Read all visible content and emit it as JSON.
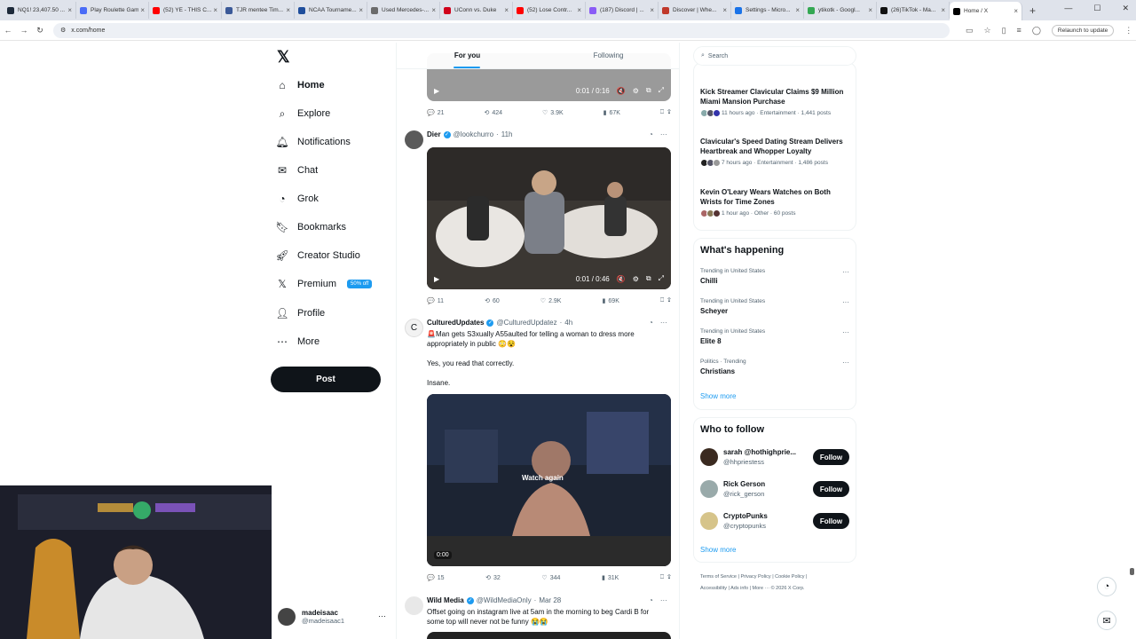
{
  "browser": {
    "tabs": [
      {
        "label": "NQ1! 23,407.50 ...",
        "color": "#1e2a3a"
      },
      {
        "label": "Play Roulette Game",
        "color": "#4a6cf7"
      },
      {
        "label": "(52) YE - THIS C...",
        "color": "#ff0000"
      },
      {
        "label": "TJR mentee Tim...",
        "color": "#3b5998"
      },
      {
        "label": "NCAA Tourname...",
        "color": "#1f4e9c"
      },
      {
        "label": "Used Mercedes-...",
        "color": "#6b6b6b"
      },
      {
        "label": "UConn vs. Duke",
        "color": "#d0021b"
      },
      {
        "label": "(52) Lose Contr...",
        "color": "#ff0000"
      },
      {
        "label": "(187) Discord | ...",
        "color": "#8a5cf6"
      },
      {
        "label": "Discover | Whe...",
        "color": "#c0392b"
      },
      {
        "label": "Settings - Micro...",
        "color": "#1a73e8"
      },
      {
        "label": "ytikotk - Googl...",
        "color": "#34a853"
      },
      {
        "label": "(26)TikTok - Ma...",
        "color": "#111111"
      },
      {
        "label": "Home / X",
        "color": "#000000"
      }
    ],
    "url": "x.com/home",
    "relaunch": "Relaunch to update"
  },
  "sidebar": {
    "items": [
      {
        "label": "Home",
        "icon": "home-icon"
      },
      {
        "label": "Explore",
        "icon": "search-icon"
      },
      {
        "label": "Notifications",
        "icon": "bell-icon"
      },
      {
        "label": "Chat",
        "icon": "mail-icon"
      },
      {
        "label": "Grok",
        "icon": "grok-icon"
      },
      {
        "label": "Bookmarks",
        "icon": "bookmark-icon"
      },
      {
        "label": "Creator Studio",
        "icon": "rocket-icon"
      },
      {
        "label": "Premium",
        "icon": "x-logo-icon"
      },
      {
        "label": "Profile",
        "icon": "person-icon"
      },
      {
        "label": "More",
        "icon": "more-circle-icon"
      }
    ],
    "premium_badge": "50% off",
    "post_label": "Post",
    "account": {
      "name": "madeisaac",
      "handle": "@madeisaac1"
    }
  },
  "feed": {
    "tabs": [
      "For you",
      "Following"
    ],
    "video1": {
      "time": "0:01 / 0:16",
      "replies": "21",
      "reposts": "424",
      "likes": "3.9K",
      "views": "67K"
    },
    "tweet2": {
      "name": "Dier",
      "handle": "@lookchurro",
      "time": "11h",
      "video_time": "0:01 / 0:46",
      "replies": "11",
      "reposts": "60",
      "likes": "2.9K",
      "views": "69K"
    },
    "tweet3": {
      "name": "CulturedUpdates",
      "handle": "@CulturedUpdatez",
      "time": "4h",
      "text1": "🚨Man gets S3xually A55aulted for telling a woman to dress more appropriately in public 😳😵",
      "text2": "Yes, you read that correctly.",
      "text3": "Insane.",
      "watch_again": "Watch again",
      "video_time": "0:00",
      "replies": "15",
      "reposts": "32",
      "likes": "344",
      "views": "31K"
    },
    "tweet4": {
      "name": "Wild Media",
      "handle": "@WildMediaOnly",
      "time": "Mar 28",
      "text": "Offset going on instagram live at 5am in the morning to beg Cardi B for some top will never not be funny 😭😭"
    }
  },
  "right": {
    "search_placeholder": "Search",
    "news": [
      {
        "title": "Kick Streamer Clavicular Claims $9 Million Miami Mansion Purchase",
        "meta": "11 hours ago · Entertainment · 1,441 posts"
      },
      {
        "title": "Clavicular's Speed Dating Stream Delivers Heartbreak and Whopper Loyalty",
        "meta": "7 hours ago · Entertainment · 1,486 posts"
      },
      {
        "title": "Kevin O'Leary Wears Watches on Both Wrists for Time Zones",
        "meta": "1 hour ago · Other · 60 posts"
      }
    ],
    "happening_title": "What's happening",
    "trends": [
      {
        "context": "Trending in United States",
        "name": "Chilli"
      },
      {
        "context": "Trending in United States",
        "name": "Scheyer"
      },
      {
        "context": "Trending in United States",
        "name": "Elite 8"
      },
      {
        "context": "Politics · Trending",
        "name": "Christians"
      }
    ],
    "show_more": "Show more",
    "follow_title": "Who to follow",
    "follow": [
      {
        "name": "sarah @hothighprie...",
        "handle": "@hhpriestess",
        "button": "Follow"
      },
      {
        "name": "Rick Gerson",
        "handle": "@rick_gerson",
        "button": "Follow"
      },
      {
        "name": "CryptoPunks",
        "handle": "@cryptopunks",
        "button": "Follow"
      }
    ],
    "footer1": "Terms of Service  |  Privacy Policy  |  Cookie Policy  |",
    "footer2": "Accessibility  |  Ads info  |  More ···  © 2026 X Corp."
  }
}
